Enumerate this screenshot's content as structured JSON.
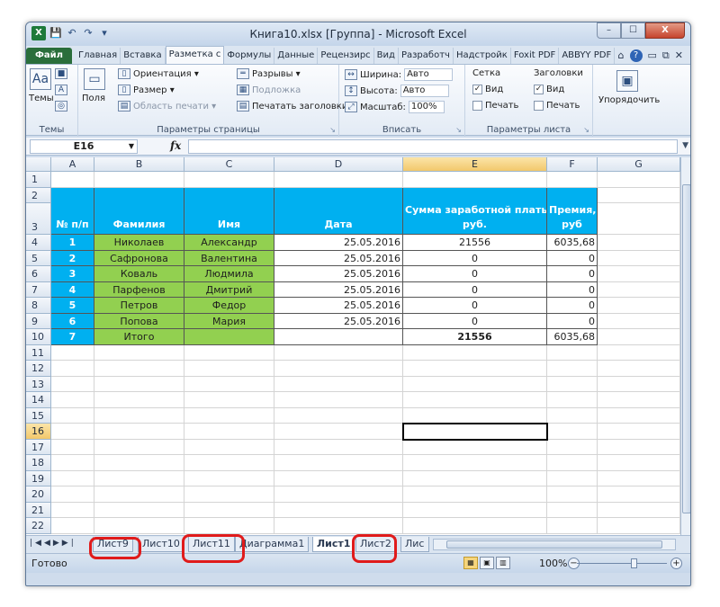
{
  "window": {
    "title": "Книга10.xlsx  [Группа]  -  Microsoft Excel",
    "qat": {
      "app_icon": "X",
      "save": "💾",
      "undo": "↶",
      "redo": "↷",
      "customize": "▾"
    },
    "controls": {
      "minimize": "–",
      "maximize": "☐",
      "close": "X"
    }
  },
  "ribbon_tabs": [
    "Файл",
    "Главная",
    "Вставка",
    "Разметка с",
    "Формулы",
    "Данные",
    "Рецензирс",
    "Вид",
    "Разработч",
    "Надстройк",
    "Foxit PDF",
    "ABBYY PDF"
  ],
  "ribbon_tab_right": {
    "collapse": "⌂",
    "help": "?",
    "min": "▭",
    "restore": "⧉",
    "close": "✕"
  },
  "ribbon": {
    "themes": {
      "label": "Темы",
      "group": "Темы"
    },
    "page_setup": {
      "fields": "Поля",
      "orientation": "Ориентация ▾",
      "size": "Размер ▾",
      "print_area": "Область печати ▾",
      "breaks": "Разрывы ▾",
      "background": "Подложка",
      "print_titles": "Печатать заголовки",
      "group": "Параметры страницы"
    },
    "scale": {
      "width_label": "Ширина:",
      "width_value": "Авто",
      "height_label": "Высота:",
      "height_value": "Авто",
      "scale_label": "Масштаб:",
      "scale_value": "100%",
      "group": "Вписать"
    },
    "sheet_options": {
      "grid": "Сетка",
      "headers": "Заголовки",
      "view": "Вид",
      "print": "Печать",
      "grid_view_checked": "✓",
      "headers_view_checked": "✓",
      "group": "Параметры листа"
    },
    "arrange": {
      "label": "Упорядочить"
    }
  },
  "formula_bar": {
    "name_box": "E16",
    "fx": "fx",
    "content": ""
  },
  "columns": [
    "A",
    "B",
    "C",
    "D",
    "E",
    "F",
    "G"
  ],
  "rows": [
    "1",
    "2",
    "3",
    "4",
    "5",
    "6",
    "7",
    "8",
    "9",
    "10",
    "11",
    "12",
    "13",
    "14",
    "15",
    "16",
    "17",
    "18",
    "19",
    "20",
    "21",
    "22"
  ],
  "selected_cell": {
    "col": "E",
    "row": "16"
  },
  "table": {
    "header_row_1": {
      "E": "Сумма заработной платы,",
      "F": "Премия,"
    },
    "headers": {
      "A": "№ п/п",
      "B": "Фамилия",
      "C": "Имя",
      "D": "Дата",
      "E": "руб.",
      "F": "руб"
    },
    "rows": [
      {
        "A": "1",
        "B": "Николаев",
        "C": "Александр",
        "D": "25.05.2016",
        "E": "21556",
        "F": "6035,68"
      },
      {
        "A": "2",
        "B": "Сафронова",
        "C": "Валентина",
        "D": "25.05.2016",
        "E": "0",
        "F": "0"
      },
      {
        "A": "3",
        "B": "Коваль",
        "C": "Людмила",
        "D": "25.05.2016",
        "E": "0",
        "F": "0"
      },
      {
        "A": "4",
        "B": "Парфенов",
        "C": "Дмитрий",
        "D": "25.05.2016",
        "E": "0",
        "F": "0"
      },
      {
        "A": "5",
        "B": "Петров",
        "C": "Федор",
        "D": "25.05.2016",
        "E": "0",
        "F": "0"
      },
      {
        "A": "6",
        "B": "Попова",
        "C": "Мария",
        "D": "25.05.2016",
        "E": "0",
        "F": "0"
      },
      {
        "A": "7",
        "B": "Итого",
        "C": "",
        "D": "",
        "E": "21556",
        "F": "6035,68"
      }
    ]
  },
  "sheet_tabs": [
    "Лист9",
    "Лист10",
    "Лист11",
    "Диаграмма1",
    "Лист1",
    "Лист2",
    "Лис"
  ],
  "active_sheet": "Лист1",
  "highlighted_tabs": [
    "Лист9",
    "Лист11",
    "Лист2"
  ],
  "status": {
    "ready": "Готово",
    "zoom": "100%",
    "zoom_out": "−",
    "zoom_in": "+"
  },
  "colors": {
    "green_cell": "#92d050",
    "header_cell": "#00b0f0",
    "highlight_ring": "#e01b1b",
    "file_tab": "#2a6e3b"
  }
}
